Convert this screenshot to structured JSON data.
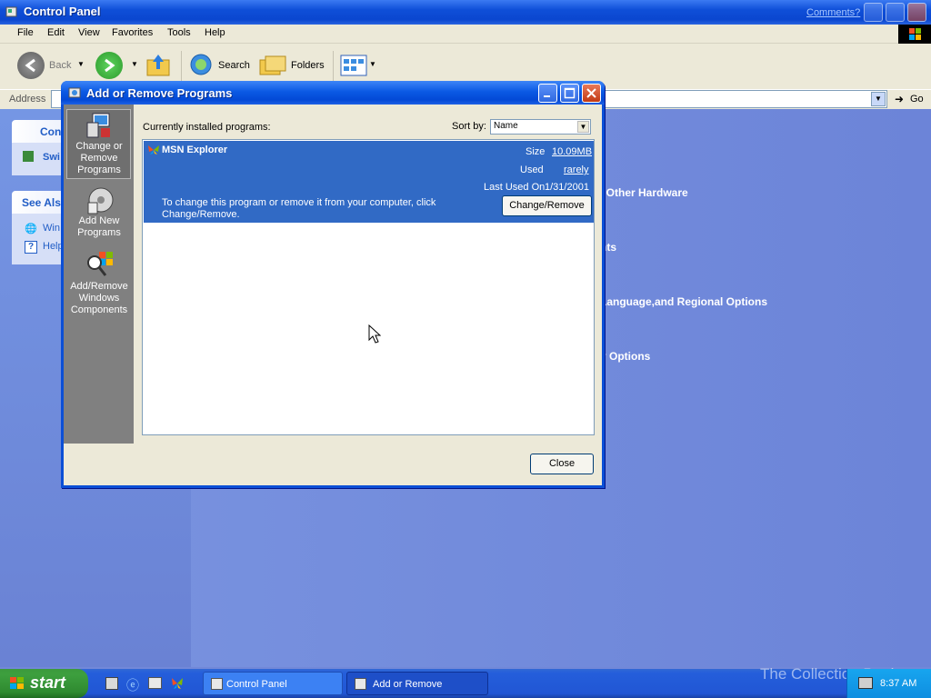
{
  "window": {
    "title": "Control Panel",
    "comments_link": "Comments?"
  },
  "menu": [
    "File",
    "Edit",
    "View",
    "Favorites",
    "Tools",
    "Help"
  ],
  "toolbar": {
    "back_label": "Back",
    "search_label": "Search",
    "folders_label": "Folders"
  },
  "address": {
    "label": "Address",
    "go_label": "Go"
  },
  "left_panel": {
    "header_partial": "Con",
    "switch_partial": "Swi",
    "see_also_partial": "See Als",
    "link1_partial": "Win",
    "link2_partial": "Help"
  },
  "categories": [
    "l Other Hardware",
    "nts",
    " Language,and Regional Options",
    "y Options"
  ],
  "dialog": {
    "title": "Add or Remove Programs",
    "side_items": [
      {
        "label": "Change or Remove Programs",
        "icon": "change-remove-programs-icon"
      },
      {
        "label": "Add New Programs",
        "icon": "add-new-programs-icon"
      },
      {
        "label": "Add/Remove Windows Components",
        "icon": "windows-components-icon"
      }
    ],
    "installed_label": "Currently installed programs:",
    "sort_label": "Sort by:",
    "sort_value": "Name",
    "program": {
      "name": "MSN Explorer",
      "size_label": "Size",
      "size_value": "10.09MB",
      "used_label": "Used",
      "used_value": "rarely",
      "last_used_label": "Last Used On",
      "last_used_value": "1/31/2001",
      "description": "To change this program or remove it from your computer, click Change/Remove.",
      "change_button": "Change/Remove"
    },
    "close_button": "Close"
  },
  "taskbar": {
    "start_label": "start",
    "tasks": [
      "Control Panel",
      "Add or Remove Programs"
    ],
    "clock": "8:37 AM"
  },
  "watermark": "The Collection Book",
  "colors": {
    "selection_blue": "#316ac5",
    "title_blue": "#0b5ae4",
    "start_green": "#3d9f3e"
  }
}
